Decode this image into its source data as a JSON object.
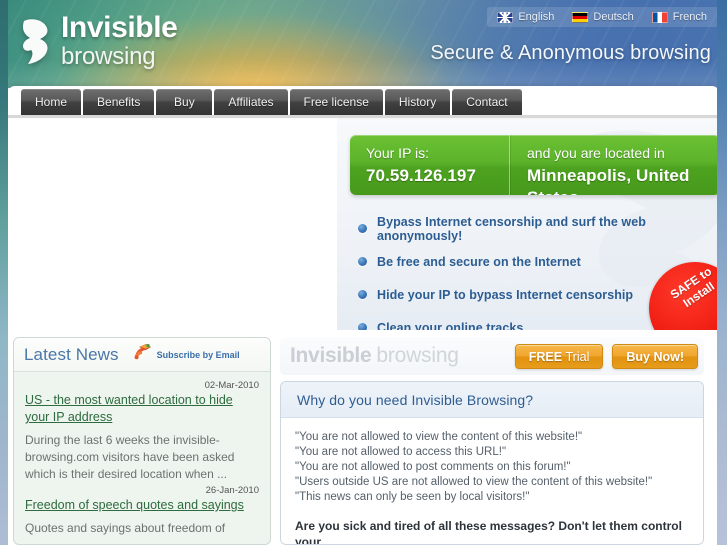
{
  "header": {
    "logo": {
      "word1": "Invisible",
      "word2": "browsing",
      "icon": "ghost-logo-icon"
    },
    "tagline": "Secure & Anonymous browsing",
    "languages": [
      {
        "label": "English",
        "flag": "flag-uk-icon"
      },
      {
        "label": "Deutsch",
        "flag": "flag-de-icon"
      },
      {
        "label": "French",
        "flag": "flag-fr-icon"
      }
    ]
  },
  "nav": {
    "items": [
      {
        "label": "Home"
      },
      {
        "label": "Benefits"
      },
      {
        "label": "Buy"
      },
      {
        "label": "Affiliates"
      },
      {
        "label": "Free license"
      },
      {
        "label": "History"
      },
      {
        "label": "Contact"
      }
    ]
  },
  "hero": {
    "ip_label": "Your IP is:",
    "ip_value": "70.59.126.197",
    "location_label": "and you are located in",
    "location_value": "Minneapolis, United States",
    "benefits": [
      "Bypass Internet censorship and surf the web anonymously!",
      "Be free and secure on the Internet",
      "Hide your IP to bypass Internet censorship",
      "Clean your online tracks"
    ],
    "safe_badge_line1": "SAFE to",
    "safe_badge_line2": "Install"
  },
  "news": {
    "title": "Latest News",
    "subscribe_label": "Subscribe by Email",
    "subscribe_icon": "rss-email-icon",
    "items": [
      {
        "date": "02-Mar-2010",
        "headline": "US - the most wanted location to hide your IP address",
        "summary": "During the last 6 weeks the invisible-browsing.com visitors have been asked which is their desired location when ..."
      },
      {
        "date": "26-Jan-2010",
        "headline": "Freedom of speech quotes and sayings",
        "summary": "Quotes and sayings about freedom of"
      }
    ]
  },
  "promo": {
    "brand_word1": "Invisible",
    "brand_word2": "browsing",
    "free_trial_strong": "FREE",
    "free_trial_light": "Trial",
    "buy_now": "Buy Now!",
    "panel_title": "Why do you need Invisible Browsing?",
    "quotes": [
      "\"You are not allowed to view the content of this website!\"",
      "\"You are not allowed to access this URL!\"",
      "\"You are not allowed to post comments on this forum!\"",
      "\"Users outside US are not allowed to view the content of this website!\"",
      "\"This news can only be seen by local visitors!\""
    ],
    "cta": "Are you sick and tired of all these messages? Don't let them control your"
  },
  "colors": {
    "accent_green": "#5cb32b",
    "accent_orange": "#f0a52e",
    "accent_blue": "#2c5d92",
    "badge_red": "#ef1b10",
    "news_link_green": "#2e6b3e"
  }
}
